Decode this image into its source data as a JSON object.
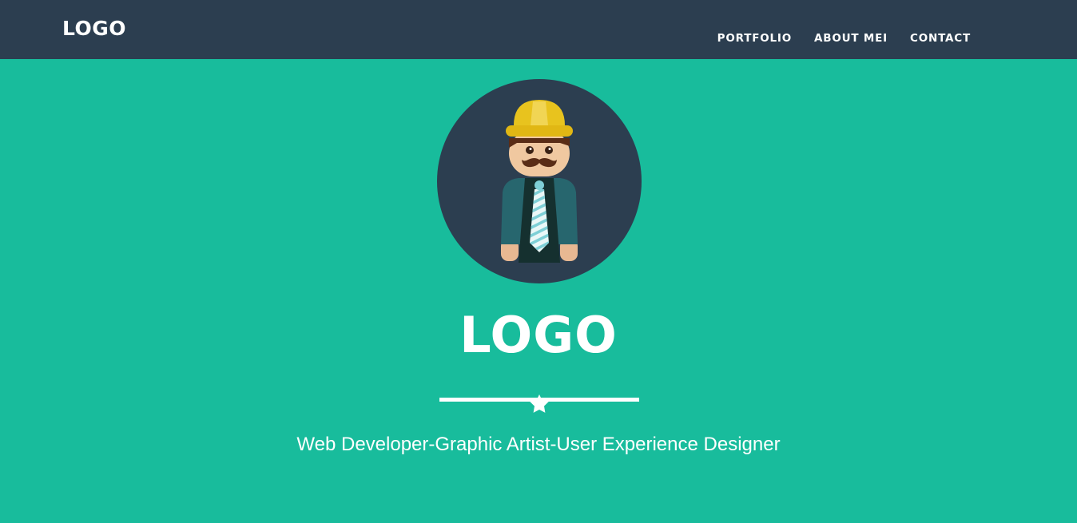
{
  "navbar": {
    "brand": "LOGO",
    "links": [
      {
        "label": "PORTFOLIO"
      },
      {
        "label": "ABOUT MEI"
      },
      {
        "label": "CONTACT"
      }
    ]
  },
  "hero": {
    "avatar_icon": "builder-avatar-icon",
    "title": "LOGO",
    "divider_icon": "star-icon",
    "tagline": "Web Developer-Graphic Artist-User Experience Designer"
  },
  "colors": {
    "navbar_bg": "#2c3e50",
    "hero_bg": "#18bc9c",
    "text": "#ffffff"
  }
}
